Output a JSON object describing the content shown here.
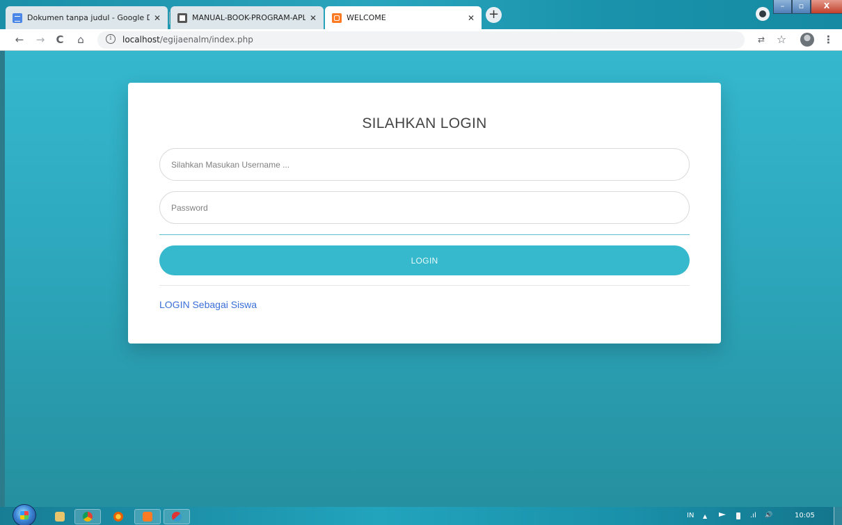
{
  "browser": {
    "tabs": [
      {
        "title": "Dokumen tanpa judul - Google D",
        "close": "✕",
        "icon": "google-docs-icon"
      },
      {
        "title": "MANUAL-BOOK-PROGRAM-APL",
        "close": "✕",
        "icon": "globe-icon"
      },
      {
        "title": "WELCOME",
        "close": "✕",
        "icon": "xampp-icon"
      }
    ],
    "new_tab": "+",
    "nav": {
      "back": "←",
      "forward": "→",
      "reload": "C",
      "home": "⌂"
    },
    "url": {
      "host": "localhost",
      "path": "/egijaenalm/index.php"
    },
    "info_icon": "i",
    "toolbar_icons": {
      "translate": "⇄",
      "star": "☆",
      "menu": "⋮"
    },
    "window_controls": {
      "minimize": "–",
      "maximize": "▫",
      "close": "X"
    }
  },
  "login": {
    "title": "SILAHKAN LOGIN",
    "username_placeholder": "Silahkan Masukan Username ...",
    "password_placeholder": "Password",
    "button": "LOGIN",
    "siswa_link": "LOGIN Sebagai Siswa"
  },
  "taskbar": {
    "lang": "IN",
    "tray_arrow": "▲",
    "volume": "🔊",
    "signal": ".ıl",
    "time": "10:05"
  },
  "colors": {
    "accent": "#36b9cc",
    "page_bg_top": "#35b8ce",
    "link": "#3a6fd8"
  }
}
